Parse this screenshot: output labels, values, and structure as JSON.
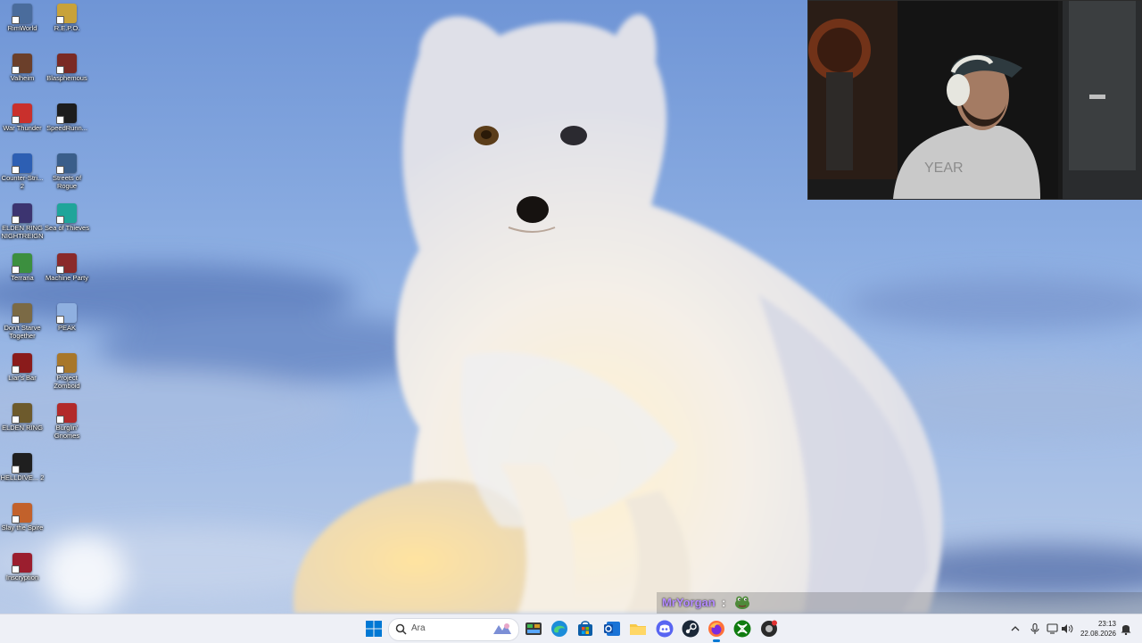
{
  "desktop": {
    "icons": [
      {
        "name": "RimWorld",
        "color": "#4a6c9c"
      },
      {
        "name": "R.E.P.O.",
        "color": "#c8a23a"
      },
      {
        "name": "Valheim",
        "color": "#6b3f2a"
      },
      {
        "name": "Blasphemous",
        "color": "#7a2a24"
      },
      {
        "name": "War Thunder",
        "color": "#c9302c"
      },
      {
        "name": "SpeedRunn...",
        "color": "#1d1d1d"
      },
      {
        "name": "Counter-Stri... 2",
        "color": "#2d5fb3"
      },
      {
        "name": "Streets of Rogue",
        "color": "#3a5e8a"
      },
      {
        "name": "ELDEN RING NIGHTREIGN",
        "color": "#3c3470"
      },
      {
        "name": "Sea of Thieves",
        "color": "#1fa59a"
      },
      {
        "name": "Terraria",
        "color": "#3c8f3f"
      },
      {
        "name": "Machine Party",
        "color": "#8a2a2a"
      },
      {
        "name": "Don't Starve Together",
        "color": "#7b6a45"
      },
      {
        "name": "PEAK",
        "color": "#8fb0e0"
      },
      {
        "name": "Liar's Bar",
        "color": "#8a1b1b"
      },
      {
        "name": "Project Zomboid",
        "color": "#a8772a"
      },
      {
        "name": "ELDEN RING",
        "color": "#6d5a2c"
      },
      {
        "name": "Burglin' Gnomes",
        "color": "#b22a2a"
      },
      {
        "name": "HELLDIVE... 2",
        "color": "#1f1f1f"
      },
      {
        "name": "Slay the Spire",
        "color": "#c2612b"
      },
      {
        "name": "Inscryption",
        "color": "#9b1e2e"
      }
    ]
  },
  "chat": {
    "username": "MrYorgan",
    "separator": ":",
    "emote": "frog-emote",
    "username_color": "#b48bff"
  },
  "taskbar": {
    "search_placeholder": "Ara",
    "pinned": [
      {
        "name": "discord",
        "color": "#5865f2"
      },
      {
        "name": "steam",
        "color": "#1b2838"
      },
      {
        "name": "firefox",
        "color": "#ff7139"
      },
      {
        "name": "xbox",
        "color": "#107c10"
      }
    ],
    "clock_time": "23:13",
    "clock_date": "22.08.2026",
    "accent": "#0078d4"
  }
}
